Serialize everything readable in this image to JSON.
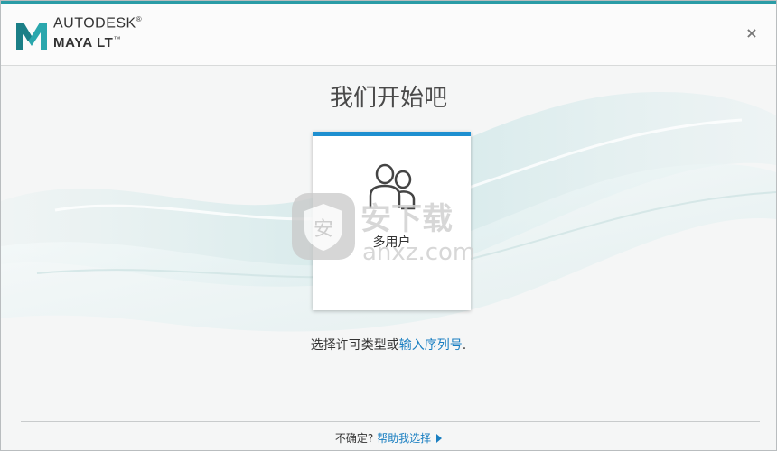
{
  "header": {
    "brand_line1": "AUTODESK",
    "brand_line1_mark": "®",
    "brand_line2": "MAYA LT",
    "brand_line2_mark": "™",
    "close_glyph": "×"
  },
  "main": {
    "title": "我们开始吧",
    "license_option": {
      "label": "多用户",
      "icon": "users-icon"
    },
    "instruction_text": "选择许可类型或",
    "serial_link": "输入序列号",
    "instruction_end": "."
  },
  "watermark": {
    "text_cn": "安下载",
    "text_en": "anxz.com",
    "badge_char": "安"
  },
  "footer": {
    "question": "不确定?",
    "help_link": "帮助我选择"
  },
  "colors": {
    "accent_teal": "#2a9ca6",
    "card_accent_blue": "#1e8fd0",
    "link_blue": "#1a7fc1"
  }
}
